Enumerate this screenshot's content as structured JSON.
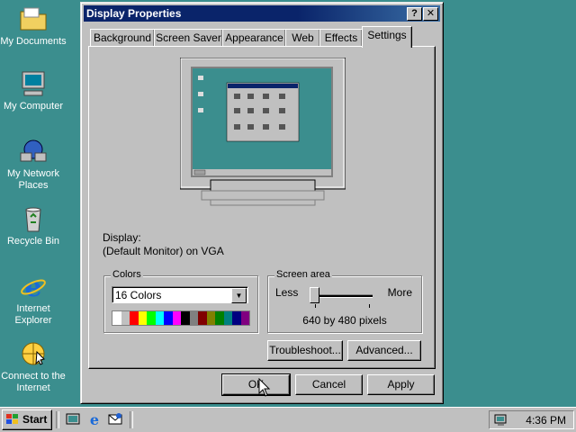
{
  "desktop": {
    "icons": [
      {
        "label": "My Documents",
        "icon": "folder-icon"
      },
      {
        "label": "My Computer",
        "icon": "computer-icon"
      },
      {
        "label": "My Network Places",
        "icon": "network-icon"
      },
      {
        "label": "Recycle Bin",
        "icon": "recycle-bin-icon"
      },
      {
        "label": "Internet Explorer",
        "icon": "ie-icon"
      },
      {
        "label": "Connect to the Internet",
        "icon": "connect-icon"
      }
    ]
  },
  "window": {
    "title": "Display Properties",
    "help_label": "?",
    "close_label": "✕",
    "tabs": [
      {
        "label": "Background"
      },
      {
        "label": "Screen Saver"
      },
      {
        "label": "Appearance"
      },
      {
        "label": "Web"
      },
      {
        "label": "Effects"
      },
      {
        "label": "Settings",
        "active": true
      }
    ],
    "display_label": "Display:",
    "display_value": "(Default Monitor) on VGA",
    "colors": {
      "group_label": "Colors",
      "selected": "16 Colors",
      "swatches": [
        "#ffffff",
        "#c0c0c0",
        "#ff0000",
        "#ffff00",
        "#00ff00",
        "#00ffff",
        "#0000ff",
        "#ff00ff",
        "#000000",
        "#808080",
        "#800000",
        "#808000",
        "#008000",
        "#008080",
        "#000080",
        "#800080"
      ]
    },
    "screen_area": {
      "group_label": "Screen area",
      "less_label": "Less",
      "more_label": "More",
      "value_text": "640 by 480 pixels",
      "slider_fraction": 0.0
    },
    "troubleshoot_label": "Troubleshoot...",
    "advanced_label": "Advanced...",
    "ok_label": "OK",
    "cancel_label": "Cancel",
    "apply_label": "Apply"
  },
  "taskbar": {
    "start_label": "Start",
    "time": "4:36 PM"
  },
  "colors": {
    "desktop": "#3b8e8e",
    "titlebar": "#0a246a",
    "face": "#c0c0c0"
  }
}
